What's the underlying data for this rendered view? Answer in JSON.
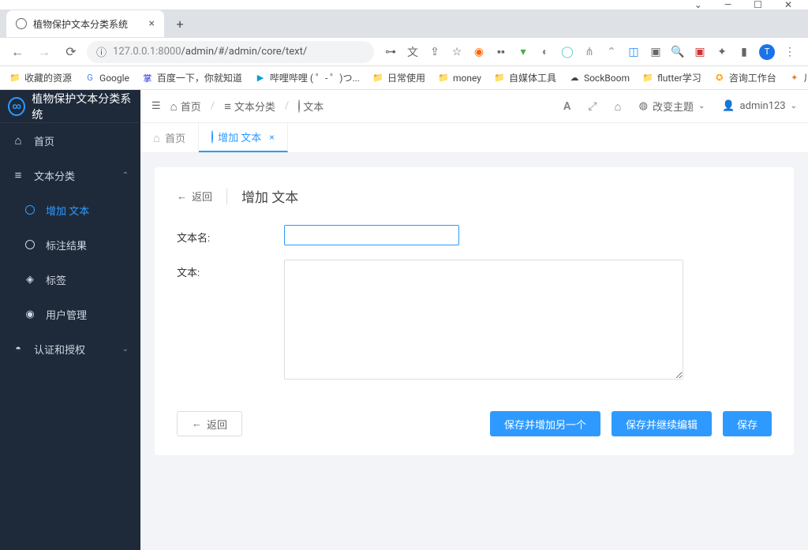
{
  "browser": {
    "tab_title": "植物保护文本分类系统",
    "url_host": "127.0.0.1",
    "url_port": ":8000",
    "url_path": "/admin/#/admin/core/text/",
    "avatar_letter": "T"
  },
  "bookmarks": [
    {
      "label": "收藏的资源"
    },
    {
      "label": "Google"
    },
    {
      "label": "百度一下，你就知道"
    },
    {
      "label": "哔哩哔哩 ( ゜- ゜)つ..."
    },
    {
      "label": "日常使用"
    },
    {
      "label": "money"
    },
    {
      "label": "自媒体工具"
    },
    {
      "label": "SockBoom"
    },
    {
      "label": "flutter学习"
    },
    {
      "label": "咨询工作台"
    },
    {
      "label": "川虎ChatGPT 🚀"
    }
  ],
  "sidebar": {
    "app_title": "植物保护文本分类系统",
    "items": [
      {
        "label": "首页"
      },
      {
        "label": "文本分类"
      },
      {
        "label": "增加 文本"
      },
      {
        "label": "标注结果"
      },
      {
        "label": "标签"
      },
      {
        "label": "用户管理"
      },
      {
        "label": "认证和授权"
      }
    ]
  },
  "topbar": {
    "crumbs": [
      "首页",
      "文本分类",
      "文本"
    ],
    "theme_label": "改变主题",
    "user_label": "admin123"
  },
  "tabs": [
    {
      "label": "首页"
    },
    {
      "label": "增加 文本"
    }
  ],
  "page": {
    "back": "返回",
    "title": "增加 文本",
    "label_name": "文本名:",
    "label_text": "文本:",
    "value_name": "",
    "value_text": "",
    "btn_back": "返回",
    "btn_save_add": "保存并增加另一个",
    "btn_save_cont": "保存并继续编辑",
    "btn_save": "保存"
  }
}
